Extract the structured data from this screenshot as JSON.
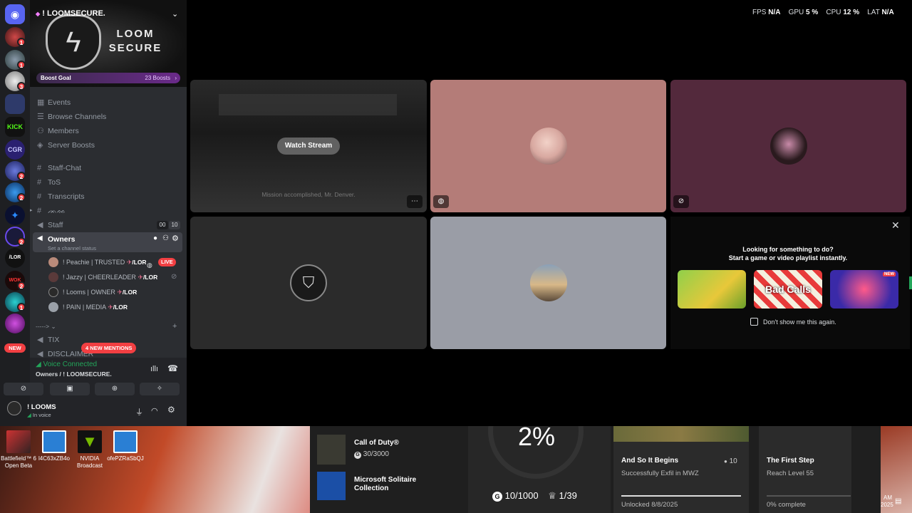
{
  "overlay": {
    "fps_label": "FPS",
    "fps_value": "N/A",
    "gpu_label": "GPU",
    "gpu_value": "5 %",
    "cpu_label": "CPU",
    "cpu_value": "12 %",
    "lat_label": "LAT",
    "lat_value": "N/A"
  },
  "server": {
    "name": "! LOOMSECURE.",
    "banner_text": "LOOM SECURE",
    "boost_goal": "Boost Goal",
    "boosts": "23 Boosts"
  },
  "menu": [
    "Events",
    "Browse Channels",
    "Members",
    "Server Boosts"
  ],
  "channels": {
    "staff_chat": "Staff-Chat",
    "tos": "ToS",
    "transcripts": "Transcripts",
    "symbols": "ᨏᨐ",
    "staff": "Staff",
    "staff_count_a": "00",
    "staff_count_b": "10",
    "owners": "Owners",
    "owners_status": "Set a channel status",
    "divider": "----->",
    "tix": "TIX",
    "disclaimer": "DISCLAIMER",
    "new_mentions": "4 NEW MENTIONS"
  },
  "voice_users": [
    {
      "name": "! Peachie | TRUSTED",
      "tag": "/LOR",
      "live": "LIVE"
    },
    {
      "name": "! Jazzy | CHEERLEADER",
      "tag": "/LOR"
    },
    {
      "name": "! Looms | OWNER",
      "tag": "/LOR"
    },
    {
      "name": "! PAIN | MEDIA",
      "tag": "/LOR"
    }
  ],
  "guild_badges": [
    "1",
    "1",
    "3",
    "2",
    "2",
    "2",
    "2",
    "1"
  ],
  "guild_labels": {
    "kick": "KICK",
    "cgr": "CGR",
    "lor": "/LOR",
    "new": "NEW"
  },
  "voice_panel": {
    "status": "Voice Connected",
    "location": "Owners / ! LOOMSECURE."
  },
  "user_panel": {
    "name": "! LOOMS",
    "status": "In voice"
  },
  "stream": {
    "watch_label": "Watch Stream",
    "caption": "Mission accomplished, Mr. Denver."
  },
  "activity": {
    "line1": "Looking for something to do?",
    "line2": "Start a game or video playlist instantly.",
    "dont_show": "Don't show me this again.",
    "new_label": "NEW",
    "game2_title": "Bad Calls"
  },
  "desktop_icons": [
    {
      "label": "Battlefield™ 6 Open Beta"
    },
    {
      "label": "l4C63xZB4o"
    },
    {
      "label": "NVIDIA Broadcast"
    },
    {
      "label": "ofePZRaSbQJ"
    }
  ],
  "gamebar": {
    "game1": "Call of Duty®",
    "game1_score": "30/3000",
    "game2": "Microsoft Solitaire Collection",
    "percent": "2%",
    "g_score": "10/1000",
    "trophies": "1/39",
    "ach1_title": "And So It Begins",
    "ach1_desc": "Successfully Exfil in MWZ",
    "ach1_points": "10",
    "ach1_unlocked": "Unlocked 8/8/2025",
    "ach2_title": "The First Step",
    "ach2_desc": "Reach Level 55",
    "ach2_progress": "0% complete"
  },
  "taskbar": {
    "time": "AM",
    "date": "2025"
  },
  "colors": {
    "accent": "#5865f2",
    "live": "#f23f42",
    "connected": "#23a55a"
  }
}
